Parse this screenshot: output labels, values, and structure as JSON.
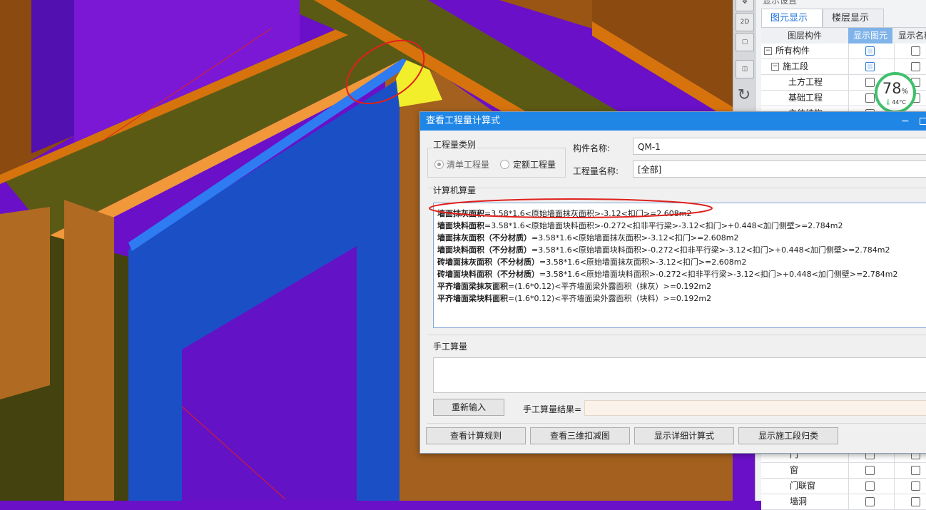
{
  "colors": {
    "bg_purple": "#6a10c8",
    "wall_brown": "#a3601e",
    "beam_olive": "#5b5a14",
    "beam_orange": "#d6730d",
    "blue_column": "#1b4fc6",
    "blue_edge": "#2e7bf2",
    "yellow_face": "#f2ee2b",
    "annotation_red": "#e0201b",
    "dialog_title": "#1f86e6",
    "gauge_green": "#3fc16b"
  },
  "toolbar": {
    "icons": [
      "pan-icon",
      "view-2d-icon",
      "cube-front-icon",
      "cube-iso-icon",
      "rotate-icon"
    ],
    "view_2d_label": "2D"
  },
  "right_panel": {
    "title": "显示设置",
    "tabs": [
      {
        "label": "图元显示",
        "active": true
      },
      {
        "label": "楼层显示",
        "active": false
      }
    ],
    "columns": [
      "图层构件",
      "显示图元",
      "显示名称"
    ],
    "rows_top": [
      {
        "label": "所有构件",
        "expander": "−",
        "show": true,
        "name": false
      },
      {
        "label": "施工段",
        "expander": "−",
        "show": true,
        "name": false
      },
      {
        "label": "土方工程",
        "show": false,
        "name": false
      },
      {
        "label": "基础工程",
        "show": false,
        "name": false
      },
      {
        "label": "主体结构",
        "show": false,
        "name": false
      }
    ],
    "rows_bottom": [
      {
        "label": "门",
        "show": false,
        "name": false
      },
      {
        "label": "窗",
        "show": false,
        "name": false
      },
      {
        "label": "门联窗",
        "show": false,
        "name": false
      },
      {
        "label": "墙洞",
        "show": false,
        "name": false
      }
    ]
  },
  "gauge": {
    "percent": "78",
    "unit": "%",
    "temp": "44°C",
    "level": 0.78
  },
  "dialog": {
    "title": "查看工程量计算式",
    "quantity_type_group": "工程量类别",
    "radio_bill": "清单工程量",
    "radio_quota": "定额工程量",
    "component_name_label": "构件名称:",
    "component_name_value": "QM-1",
    "quantity_name_label": "工程量名称:",
    "quantity_name_value": "[全部]",
    "computer_calc_label": "计算机算量",
    "formulas": [
      {
        "name": "墙面抹灰面积",
        "expr": "=3.58*1.6<原始墙面抹灰面积>-3.12<扣门>=2.608m2"
      },
      {
        "name": "墙面块料面积",
        "expr": "=3.58*1.6<原始墙面块料面积>-0.272<扣非平行梁>-3.12<扣门>+0.448<加门侧壁>=2.784m2"
      },
      {
        "name": "墙面抹灰面积（不分材质）",
        "expr": "=3.58*1.6<原始墙面抹灰面积>-3.12<扣门>=2.608m2"
      },
      {
        "name": "墙面块料面积（不分材质）",
        "expr": "=3.58*1.6<原始墙面块料面积>-0.272<扣非平行梁>-3.12<扣门>+0.448<加门侧壁>=2.784m2"
      },
      {
        "name": "砖墙面抹灰面积（不分材质）",
        "expr": "=3.58*1.6<原始墙面抹灰面积>-3.12<扣门>=2.608m2"
      },
      {
        "name": "砖墙面块料面积（不分材质）",
        "expr": "=3.58*1.6<原始墙面块料面积>-0.272<扣非平行梁>-3.12<扣门>+0.448<加门侧壁>=2.784m2"
      },
      {
        "name": "平齐墙面梁抹灰面积",
        "expr": "=(1.6*0.12)<平齐墙面梁外露面积（抹灰）>=0.192m2"
      },
      {
        "name": "平齐墙面梁块料面积",
        "expr": "=(1.6*0.12)<平齐墙面梁外露面积（块料）>=0.192m2"
      }
    ],
    "manual_calc_label": "手工算量",
    "reenter_button": "重新输入",
    "manual_result_label": "手工算量结果=",
    "btn_view_rules": "查看计算规则",
    "btn_view_3d": "查看三维扣减图",
    "btn_show_detail": "显示详细计算式",
    "btn_show_segment": "显示施工段归类"
  }
}
